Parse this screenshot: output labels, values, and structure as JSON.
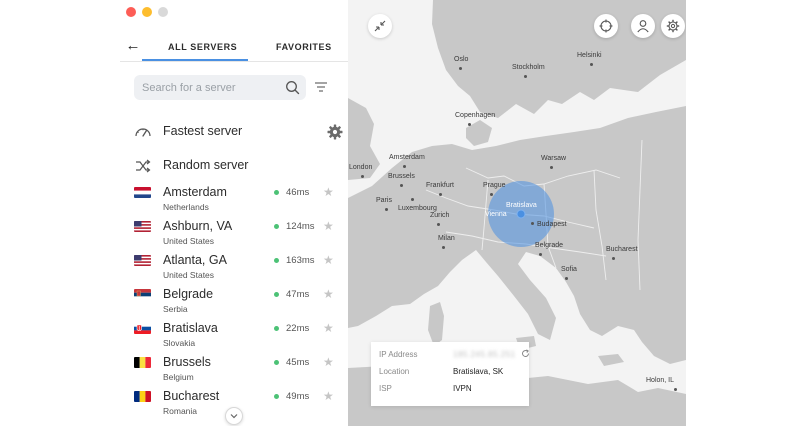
{
  "window": {
    "traffic_lights": [
      "close",
      "minimize",
      "zoom"
    ]
  },
  "tabs": {
    "all_servers": "ALL SERVERS",
    "favorites": "FAVORITES"
  },
  "search": {
    "placeholder": "Search for a server",
    "value": ""
  },
  "special_servers": {
    "fastest": "Fastest server",
    "random": "Random server"
  },
  "servers": [
    {
      "city": "Amsterdam",
      "country": "Netherlands",
      "ping": "46ms",
      "flag": "nl"
    },
    {
      "city": "Ashburn, VA",
      "country": "United States",
      "ping": "124ms",
      "flag": "us"
    },
    {
      "city": "Atlanta, GA",
      "country": "United States",
      "ping": "163ms",
      "flag": "us"
    },
    {
      "city": "Belgrade",
      "country": "Serbia",
      "ping": "47ms",
      "flag": "rs"
    },
    {
      "city": "Bratislava",
      "country": "Slovakia",
      "ping": "22ms",
      "flag": "sk"
    },
    {
      "city": "Brussels",
      "country": "Belgium",
      "ping": "45ms",
      "flag": "be"
    },
    {
      "city": "Bucharest",
      "country": "Romania",
      "ping": "49ms",
      "flag": "ro"
    }
  ],
  "map": {
    "cities": {
      "oslo": "Oslo",
      "stockholm": "Stockholm",
      "helsinki": "Helsinki",
      "copenhagen": "Copenhagen",
      "amsterdam": "Amsterdam",
      "warsaw": "Warsaw",
      "london": "London",
      "brussels": "Brussels",
      "frankfurt": "Frankfurt",
      "prague": "Prague",
      "paris": "Paris",
      "luxembourg": "Luxembourg",
      "bratislava": "Bratislava",
      "vienna": "Vienna",
      "budapest": "Budapest",
      "zurich": "Zurich",
      "milan": "Milan",
      "belgrade": "Belgrade",
      "bucharest": "Bucharest",
      "sofia": "Sofia",
      "holon": "Holon, IL"
    },
    "land_color": "#c8c8c8",
    "sea_color": "#f3f3f3",
    "accent_color": "#4a90e2"
  },
  "connection": {
    "ip_label": "IP Address",
    "ip_value": "185.245.85.251",
    "location_label": "Location",
    "location_value": "Bratislava, SK",
    "isp_label": "ISP",
    "isp_value": "IVPN"
  }
}
